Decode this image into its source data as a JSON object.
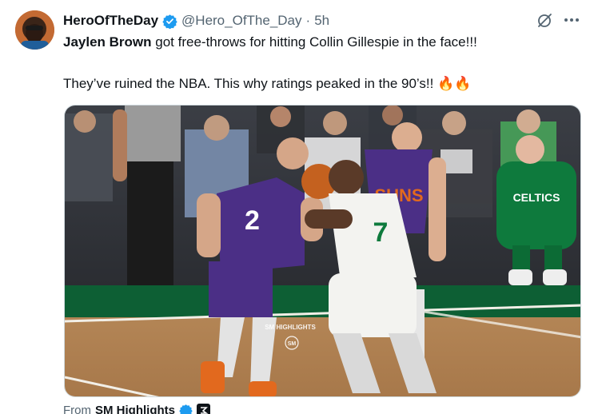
{
  "author": {
    "display_name": "HeroOfTheDay",
    "handle": "@Hero_OfThe_Day",
    "separator": "·",
    "time": "5h",
    "verified_color": "#1d9bf0"
  },
  "tweet": {
    "mention": "Jaylen Brown",
    "line1_rest": " got free-throws for hitting Collin Gillespie in the face!!!",
    "line2": "They’ve ruined the NBA. This why ratings peaked in the 90’s!! 🔥🔥"
  },
  "media": {
    "watermark": "SM HIGHLIGHTS",
    "watermark_logo": "SM",
    "jersey_suns": "2",
    "jersey_celtics": "7",
    "shirt_text": "CELTICS",
    "suns_text": "SUNS"
  },
  "footer": {
    "from_label": "From",
    "source": "SM Highlights"
  },
  "colors": {
    "text_primary": "#0f1419",
    "text_secondary": "#536471",
    "accent": "#1d9bf0",
    "suns_purple": "#4b2f86",
    "celtics_green": "#0e7a3d"
  },
  "icons": {
    "grok": "grok-icon",
    "more": "more-icon",
    "verified": "verified-badge-icon"
  }
}
